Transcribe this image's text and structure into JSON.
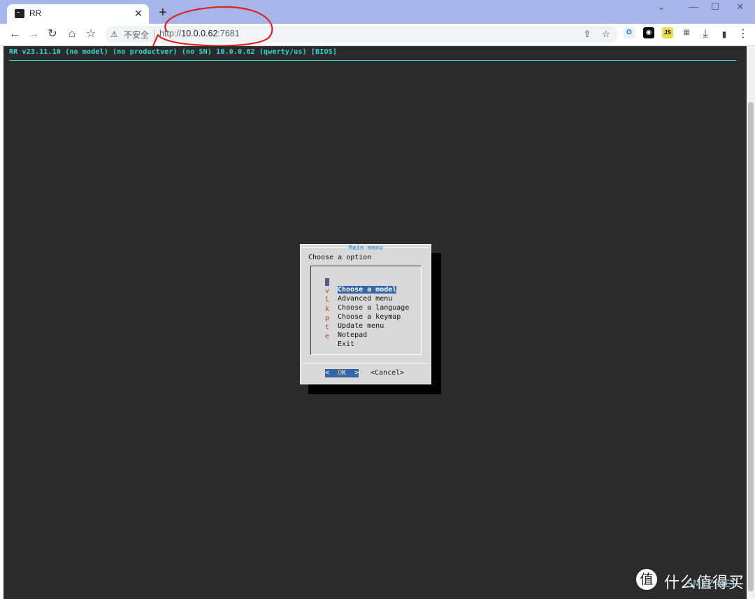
{
  "browser": {
    "tab_title": "RR",
    "tab_close": "✕",
    "new_tab": "+",
    "window_controls": {
      "dropdown": "⌄",
      "minimize": "—",
      "maximize": "☐",
      "close": "✕"
    },
    "nav": {
      "back": "←",
      "forward": "→",
      "reload": "↻",
      "home": "⌂",
      "bookmark": "☆"
    },
    "security_label": "不安全",
    "url_scheme": "http://",
    "url_host": "10.0.0.62",
    "url_port": ":7681",
    "omnibox_icons": {
      "share": "⇪",
      "star": "☆"
    },
    "extensions": [
      {
        "name": "translate",
        "glyph": "G",
        "color": "#1a73e8"
      },
      {
        "name": "ghost",
        "glyph": "◉",
        "color": "#000000"
      },
      {
        "name": "js",
        "glyph": "JS",
        "color": "#f0db4f"
      },
      {
        "name": "puzzle",
        "glyph": "▦",
        "color": "#5f6368"
      }
    ],
    "toolbar_right": {
      "download": "⤓",
      "sidepanel": "▮",
      "menu": "⋮"
    },
    "annotation_color": "#e02020"
  },
  "terminal": {
    "header": "RR v23.11.10 (no model) (no productver) (no SN) 10.0.0.62 (qwerty/us) [BIOS]",
    "accent_color": "#3ad3d3",
    "dialog": {
      "title": "Main menu",
      "prompt": "Choose a option",
      "items": [
        {
          "key": "m",
          "label": "Choose a model",
          "selected": true
        },
        {
          "key": "v",
          "label": "Advanced menu",
          "selected": false
        },
        {
          "key": "l",
          "label": "Choose a language",
          "selected": false
        },
        {
          "key": "k",
          "label": "Choose a keymap",
          "selected": false
        },
        {
          "key": "p",
          "label": "Update menu",
          "selected": false
        },
        {
          "key": "t",
          "label": "Notepad",
          "selected": false
        },
        {
          "key": "e",
          "label": "Exit",
          "selected": false
        }
      ],
      "ok_left": "<  ",
      "ok_hot": "O",
      "ok_rest": "K  >",
      "cancel": "<Cancel>"
    }
  },
  "watermark": {
    "logo": "值",
    "text": "什么值得买",
    "sub": "SMYZ.NET"
  }
}
